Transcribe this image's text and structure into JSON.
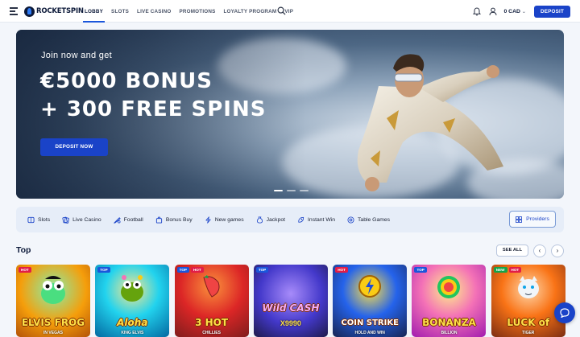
{
  "header": {
    "logo_text": "ROCKETSPIN",
    "nav": [
      {
        "label": "LOBBY",
        "active": true
      },
      {
        "label": "SLOTS",
        "active": false
      },
      {
        "label": "LIVE CASINO",
        "active": false
      },
      {
        "label": "PROMOTIONS",
        "active": false
      },
      {
        "label": "LOYALTY PROGRAM",
        "active": false
      },
      {
        "label": "VIP",
        "active": false
      }
    ],
    "balance": "0 CAD",
    "deposit_label": "DEPOSIT",
    "icons": [
      "menu-icon",
      "search-icon",
      "bell-icon",
      "user-icon",
      "chevron-down-icon"
    ]
  },
  "hero": {
    "subtitle": "Join now and get",
    "line1": "€5000 BONUS",
    "line2": "+ 300 FREE SPINS",
    "cta": "DEPOSIT NOW",
    "slides": 3,
    "active_slide": 1
  },
  "categories": [
    {
      "label": "Slots",
      "icon": "slots-icon"
    },
    {
      "label": "Live Casino",
      "icon": "live-casino-icon"
    },
    {
      "label": "Football",
      "icon": "football-icon"
    },
    {
      "label": "Bonus Buy",
      "icon": "bonus-buy-icon"
    },
    {
      "label": "New games",
      "icon": "new-games-icon"
    },
    {
      "label": "Jackpot",
      "icon": "jackpot-icon"
    },
    {
      "label": "Instant Win",
      "icon": "instant-win-icon"
    },
    {
      "label": "Table Games",
      "icon": "table-games-icon"
    }
  ],
  "providers_label": "Providers",
  "top": {
    "title": "Top",
    "see_all": "SEE ALL",
    "prev": "‹",
    "next": "›",
    "games": [
      {
        "title": "ELVIS FROG",
        "sub": "IN VEGAS",
        "badges": [
          "HOT"
        ],
        "bg": "#f59e0b"
      },
      {
        "title": "Aloha",
        "sub": "KING ELVIS",
        "badges": [
          "TOP"
        ],
        "bg": "#0ea5e9"
      },
      {
        "title": "3 HOT",
        "sub": "CHILLIES",
        "badges": [
          "TOP",
          "HOT"
        ],
        "bg": "#b91c1c"
      },
      {
        "title": "Wild CASH",
        "sub": "X9990",
        "badges": [
          "TOP"
        ],
        "bg": "#4338ca"
      },
      {
        "title": "COIN STRIKE",
        "sub": "HOLD AND WIN",
        "badges": [
          "HOT"
        ],
        "bg": "#1e3a8a"
      },
      {
        "title": "BONANZA",
        "sub": "BILLION",
        "badges": [
          "TOP"
        ],
        "bg": "#ec4899"
      },
      {
        "title": "LUCK of",
        "sub": "TIGER",
        "badges": [
          "NEW",
          "HOT"
        ],
        "bg": "#c2410c"
      }
    ]
  }
}
